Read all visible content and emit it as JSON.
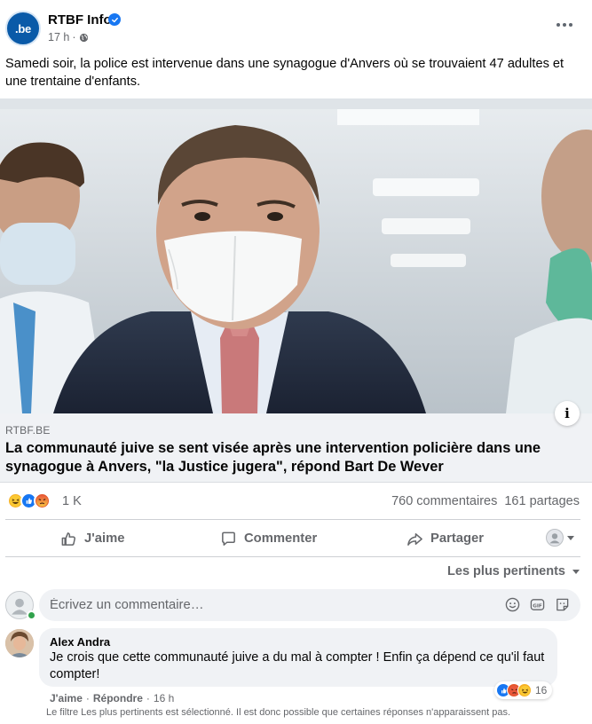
{
  "post": {
    "page_name": "RTBF Info",
    "avatar_logo_text": ".be",
    "time": "17 h",
    "separator": "·",
    "text": "Samedi soir, la police est intervenue dans une synagogue d'Anvers où se trouvaient 47 adultes et une trentaine d'enfants.",
    "colors": {
      "brand": "#0a5aa8",
      "verified": "#1877f2",
      "secondary_text": "#65676b"
    }
  },
  "link": {
    "domain": "RTBF.BE",
    "title": "La communauté juive se sent visée après une intervention policière dans une synagogue à Anvers, \"la Justice jugera\", répond Bart De Wever",
    "info_label": "i"
  },
  "reactions": {
    "icons": [
      "haha-icon",
      "like-icon",
      "angry-icon"
    ],
    "count": "1 K",
    "comments": "760 commentaires",
    "shares": "161 partages"
  },
  "actions": {
    "like": "J'aime",
    "comment": "Commenter",
    "share": "Partager"
  },
  "sort": {
    "label": "Les plus pertinents"
  },
  "comment_input": {
    "placeholder": "Écrivez un commentaire…"
  },
  "comment": {
    "author": "Alex Andra",
    "text": "Je crois que cette communauté juive a du mal à compter ! Enfin ça dépend ce qu'il faut compter!",
    "reactions_icons": [
      "like-icon",
      "angry-icon",
      "haha-icon"
    ],
    "reaction_count": "16",
    "like_label": "J'aime",
    "reply_label": "Répondre",
    "time": "16 h",
    "dot": "·"
  },
  "filter_note": "Le filtre Les plus pertinents est sélectionné. Il est donc possible que certaines réponses n'apparaissent pas."
}
